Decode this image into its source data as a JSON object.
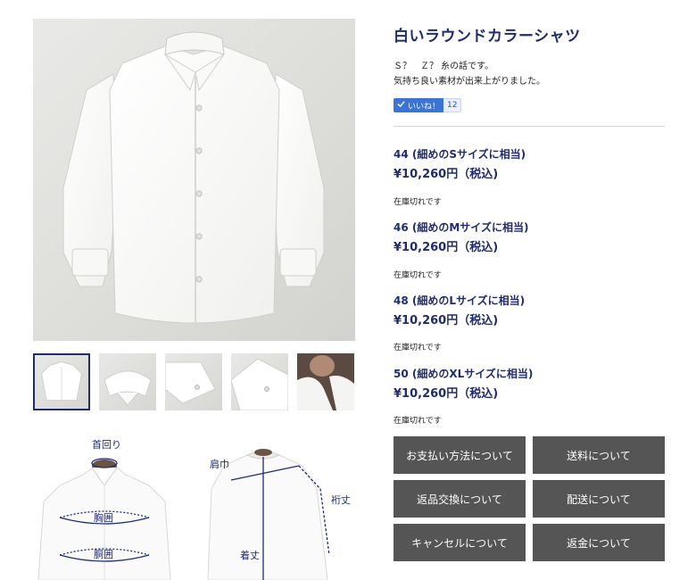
{
  "product": {
    "title": "白いラウンドカラーシャツ",
    "description_line1": "Ｓ？　Ｚ？ 糸の話です。",
    "description_line2": "気持ち良い素材が出来上がりました。",
    "like_label": "いいね！",
    "like_count": "12"
  },
  "variants": [
    {
      "name": "44 (細めのSサイズに相当)",
      "price": "¥10,260円（税込)",
      "stock": "在庫切れです"
    },
    {
      "name": "46 (細めのMサイズに相当)",
      "price": "¥10,260円（税込)",
      "stock": "在庫切れです"
    },
    {
      "name": "48 (細めのLサイズに相当)",
      "price": "¥10,260円（税込)",
      "stock": "在庫切れです"
    },
    {
      "name": "50 (細めのXLサイズに相当)",
      "price": "¥10,260円（税込)",
      "stock": "在庫切れです"
    }
  ],
  "info_buttons": [
    "お支払い方法について",
    "送料について",
    "返品交換について",
    "配送について",
    "キャンセルについて",
    "返金について"
  ],
  "diagram_labels": {
    "neck": "首回り",
    "chest": "胸囲",
    "waist": "胴囲",
    "shoulder": "肩巾",
    "length": "着丈",
    "sleeve": "裄丈"
  },
  "thumbnails": [
    {
      "name": "thumb-full-shirt",
      "active": true
    },
    {
      "name": "thumb-collar",
      "active": false
    },
    {
      "name": "thumb-cuff",
      "active": false
    },
    {
      "name": "thumb-sleeve-detail",
      "active": false
    },
    {
      "name": "thumb-worn",
      "active": false
    }
  ],
  "colors": {
    "accent": "#1f2c6e",
    "button_bg": "#555555",
    "like_blue": "#3b74d9"
  },
  "icons": {
    "like": "checkmark-icon"
  }
}
